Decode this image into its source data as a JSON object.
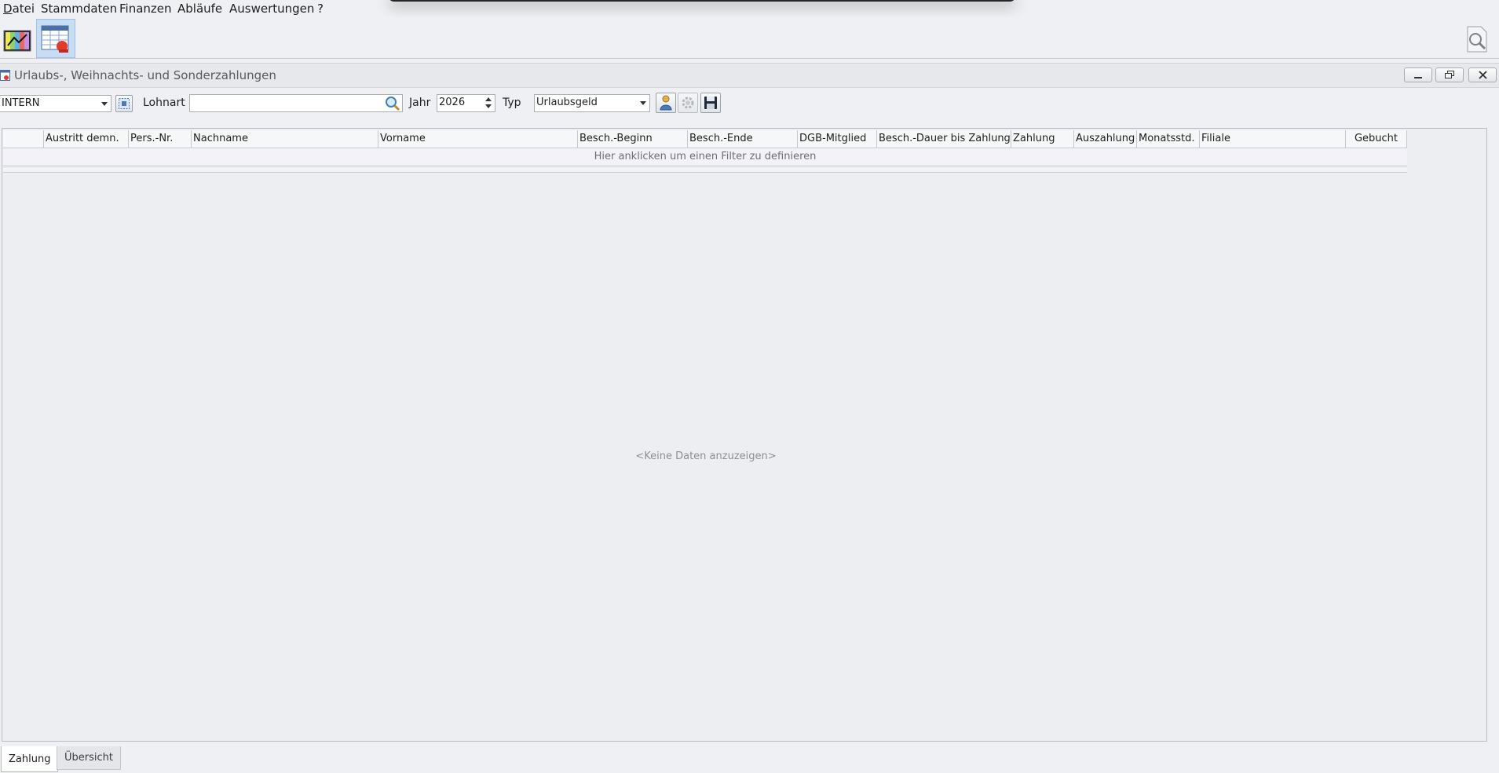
{
  "menu": {
    "items": [
      {
        "first": "D",
        "rest": "atei"
      },
      {
        "first": "",
        "rest": "Stammdaten"
      },
      {
        "first": "",
        "rest": "Finanzen"
      },
      {
        "first": "",
        "rest": "Abläufe"
      },
      {
        "first": "",
        "rest": "Auswertungen"
      },
      {
        "first": "",
        "rest": "?"
      }
    ]
  },
  "window": {
    "title": "Urlaubs-, Weihnachts- und Sonderzahlungen"
  },
  "filters": {
    "company_value": "INTERN",
    "lohnart_label": "Lohnart",
    "lohnart_value": "",
    "jahr_label": "Jahr",
    "jahr_value": "2026",
    "typ_label": "Typ",
    "typ_value": "Urlaubsgeld"
  },
  "grid": {
    "columns": [
      "",
      "Austritt demn.",
      "Pers.-Nr.",
      "Nachname",
      "Vorname",
      "Besch.-Beginn",
      "Besch.-Ende",
      "DGB-Mitglied",
      "Besch.-Dauer bis Zahlung",
      "Zahlung",
      "Auszahlung",
      "Monatsstd.",
      "Filiale",
      "Gebucht"
    ],
    "filter_hint": "Hier anklicken um einen Filter zu definieren",
    "empty_text": "<Keine Daten anzuzeigen>"
  },
  "tabs": {
    "zahlung": "Zahlung",
    "uebersicht": "Übersicht"
  }
}
